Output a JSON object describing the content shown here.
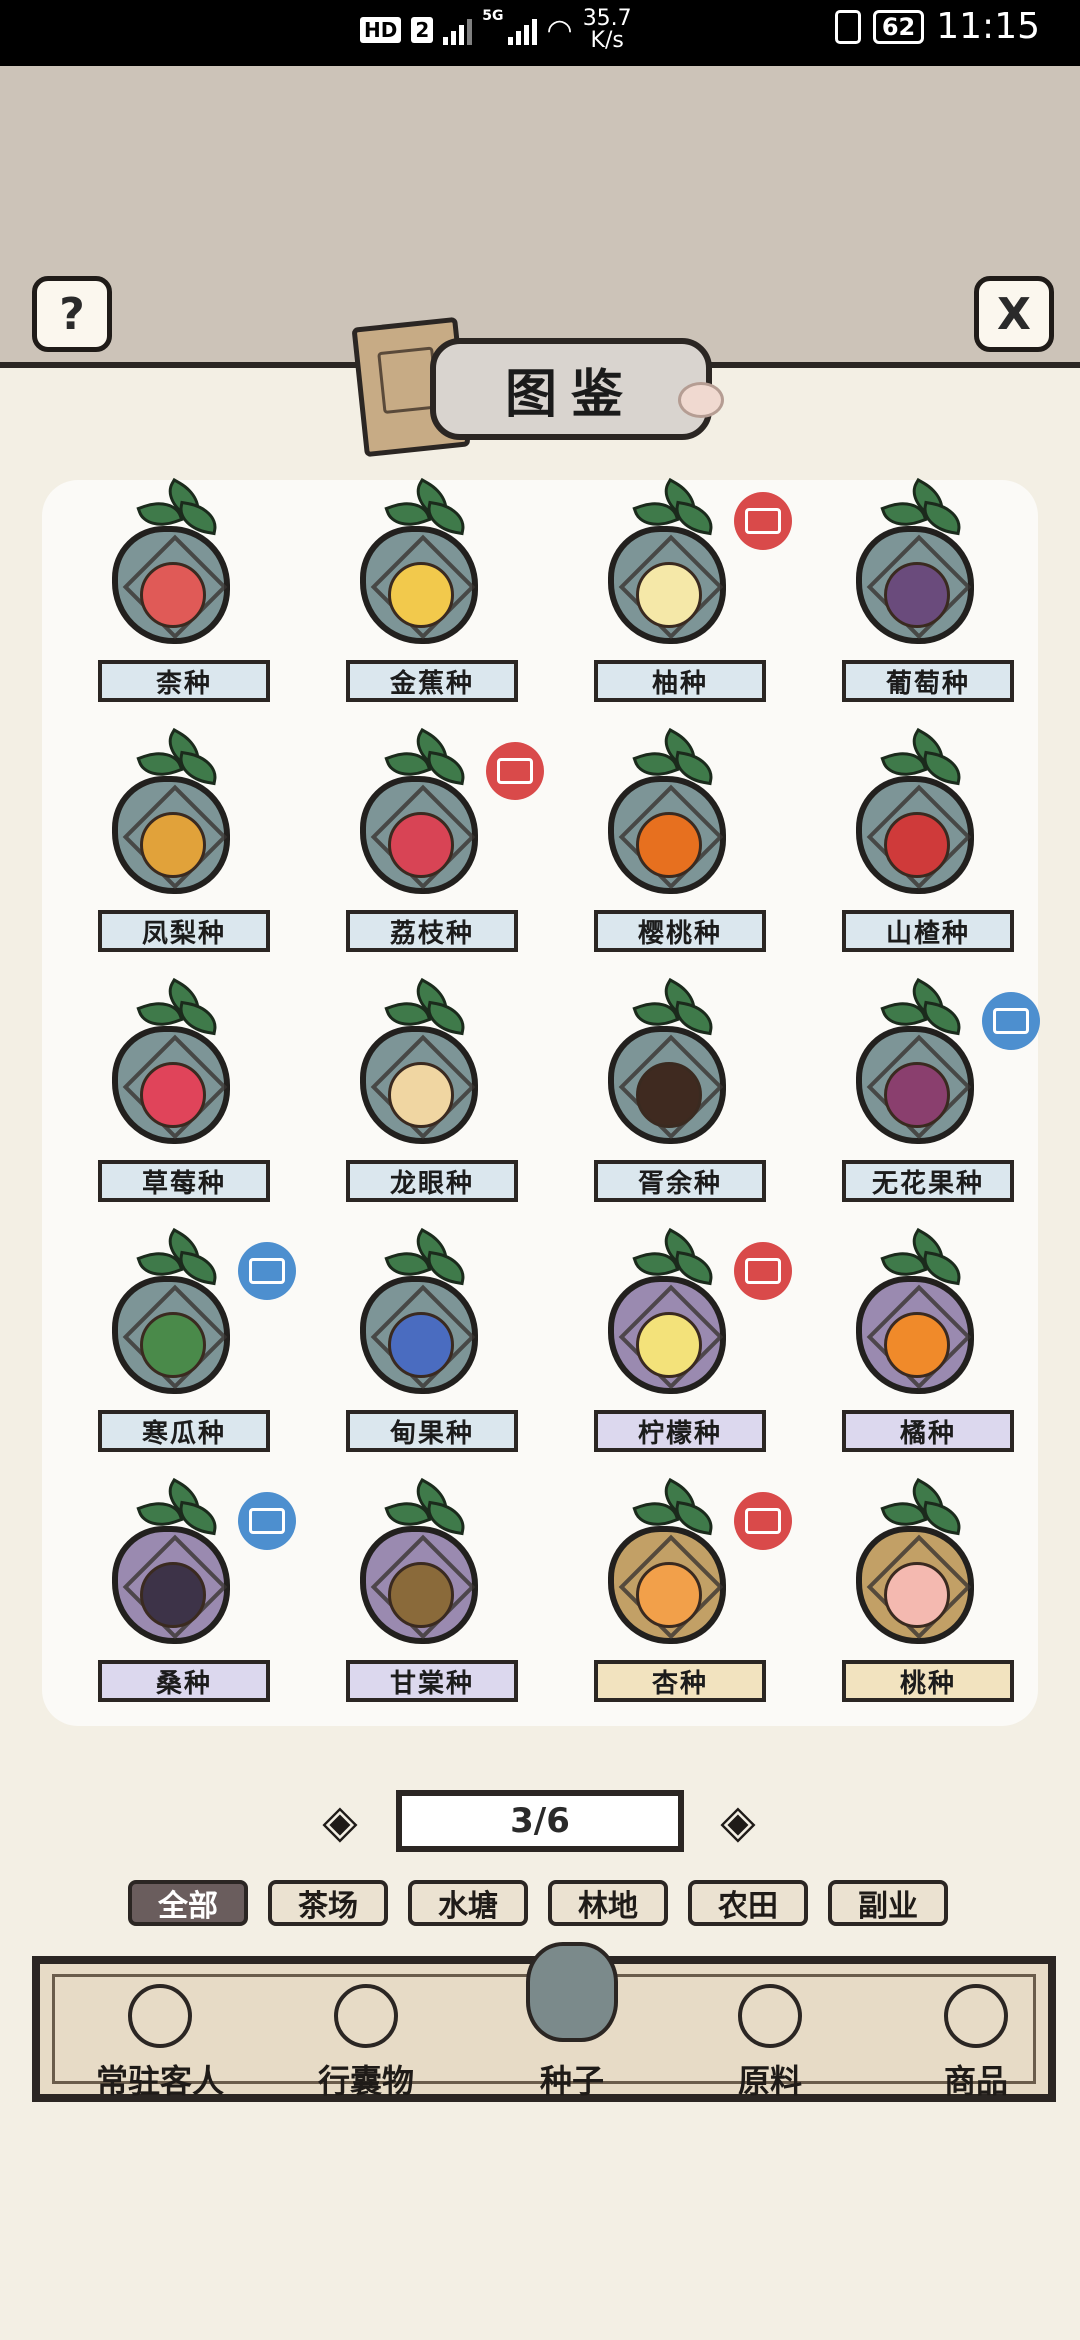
{
  "status_bar": {
    "hd_label": "HD",
    "sim_label": "2",
    "network_label": "5G",
    "speed_value": "35.7",
    "speed_unit": "K/s",
    "battery": "62",
    "time": "11:15"
  },
  "header": {
    "title": "图鉴",
    "help_symbol": "?",
    "close_symbol": "X"
  },
  "colors": {
    "blue_bag": "#7d9597",
    "purple_bag": "#9a8ab0",
    "gold_bag": "#c2a066",
    "blue_label": "#dbe7ee",
    "purple_label": "#dcd8ee",
    "gold_label": "#f2e3bf",
    "red_badge": "#d94a4a",
    "blue_badge": "#4d8fcf"
  },
  "seeds": [
    {
      "name": "柰种",
      "bag": "blue",
      "fruit_color": "#e05a57",
      "badge": ""
    },
    {
      "name": "金蕉种",
      "bag": "blue",
      "fruit_color": "#f2c94c",
      "badge": ""
    },
    {
      "name": "柚种",
      "bag": "blue",
      "fruit_color": "#f5e8a8",
      "badge": "red"
    },
    {
      "name": "葡萄种",
      "bag": "blue",
      "fruit_color": "#6a4b7c",
      "badge": ""
    },
    {
      "name": "凤梨种",
      "bag": "blue",
      "fruit_color": "#e1a23a",
      "badge": ""
    },
    {
      "name": "荔枝种",
      "bag": "blue",
      "fruit_color": "#d84455",
      "badge": "red"
    },
    {
      "name": "樱桃种",
      "bag": "blue",
      "fruit_color": "#e7701f",
      "badge": ""
    },
    {
      "name": "山楂种",
      "bag": "blue",
      "fruit_color": "#cf3a3a",
      "badge": ""
    },
    {
      "name": "草莓种",
      "bag": "blue",
      "fruit_color": "#e0445a",
      "badge": ""
    },
    {
      "name": "龙眼种",
      "bag": "blue",
      "fruit_color": "#f0d6a2",
      "badge": ""
    },
    {
      "name": "胥余种",
      "bag": "blue",
      "fruit_color": "#3f2a20",
      "badge": ""
    },
    {
      "name": "无花果种",
      "bag": "blue",
      "fruit_color": "#8a3f6e",
      "badge": "blue"
    },
    {
      "name": "寒瓜种",
      "bag": "blue",
      "fruit_color": "#4a8a4a",
      "badge": "blue"
    },
    {
      "name": "甸果种",
      "bag": "blue",
      "fruit_color": "#4a6cc0",
      "badge": ""
    },
    {
      "name": "柠檬种",
      "bag": "purple",
      "fruit_color": "#f3e27a",
      "badge": "red"
    },
    {
      "name": "橘种",
      "bag": "purple",
      "fruit_color": "#f08a2a",
      "badge": ""
    },
    {
      "name": "桑种",
      "bag": "purple",
      "fruit_color": "#3d3348",
      "badge": "blue"
    },
    {
      "name": "甘棠种",
      "bag": "purple",
      "fruit_color": "#8a6a3a",
      "badge": ""
    },
    {
      "name": "杏种",
      "bag": "gold",
      "fruit_color": "#f2a04a",
      "badge": "red"
    },
    {
      "name": "桃种",
      "bag": "gold",
      "fruit_color": "#f4b9b0",
      "badge": ""
    }
  ],
  "pager": {
    "label": "3/6",
    "prev_symbol": "◈",
    "next_symbol": "◈"
  },
  "filter_tabs": [
    {
      "label": "全部",
      "active": true
    },
    {
      "label": "茶场",
      "active": false
    },
    {
      "label": "水塘",
      "active": false
    },
    {
      "label": "林地",
      "active": false
    },
    {
      "label": "农田",
      "active": false
    },
    {
      "label": "副业",
      "active": false
    }
  ],
  "bottom_nav": [
    {
      "label": "常驻客人",
      "icon": "guest-icon",
      "active": false
    },
    {
      "label": "行囊物",
      "icon": "clothing-icon",
      "active": false
    },
    {
      "label": "种子",
      "icon": "seed-bag-icon",
      "active": true
    },
    {
      "label": "原料",
      "icon": "leaf-icon",
      "active": false
    },
    {
      "label": "商品",
      "icon": "goods-icon",
      "active": false
    }
  ]
}
